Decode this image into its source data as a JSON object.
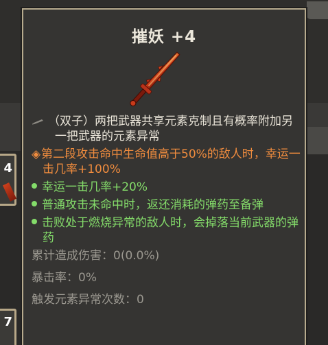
{
  "item": {
    "name": "摧妖 +4"
  },
  "description": {
    "icon": "pen-icon",
    "text": "（双子）两把武器共享元素克制且有概率附加另一把武器的元素异常"
  },
  "special_effect": {
    "icon": "diamond-icon",
    "text": "第二段攻击命中生命值高于50%的敌人时，幸运一击几率+100%"
  },
  "bullets": [
    {
      "icon": "dot-icon",
      "text": "幸运一击几率+20%"
    },
    {
      "icon": "dot-icon",
      "text": "普通攻击未命中时，返还消耗的弹药至备弹"
    },
    {
      "icon": "dot-icon",
      "text": "击败处于燃烧异常的敌人时，会掉落当前武器的弹药"
    }
  ],
  "stats": [
    {
      "text": "累计造成伤害：0(0.0%)"
    },
    {
      "text": "暴击率：0%"
    },
    {
      "text": "触发元素异常次数：0"
    }
  ],
  "background_slots": [
    {
      "label": "4"
    },
    {
      "label": "7"
    }
  ],
  "colors": {
    "panel": "#353432",
    "border": "#b7ab8e",
    "special": "#f08c3e",
    "bullet": "#84dc6a",
    "stat": "#9b9890"
  }
}
